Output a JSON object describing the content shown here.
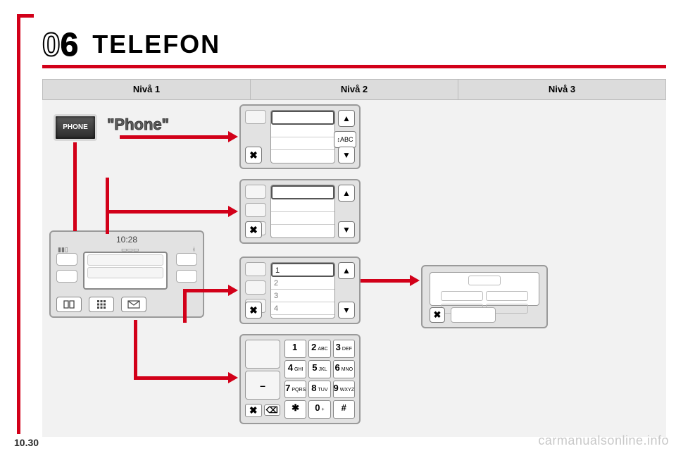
{
  "chapter": {
    "num_prefix": "0",
    "num": "6",
    "title": "TELEFON"
  },
  "columns": {
    "c1": "Nivå 1",
    "c2": "Nivå 2",
    "c3": "Nivå 3"
  },
  "phone_button": "PHONE",
  "phone_label": "\"Phone\"",
  "main_unit": {
    "time": "10:28"
  },
  "panel1": {
    "abc": "ABC"
  },
  "panel3": {
    "rows": [
      "1",
      "2",
      "3",
      "4"
    ]
  },
  "keypad": {
    "dash": "–",
    "keys": [
      {
        "d": "1",
        "s": ""
      },
      {
        "d": "2",
        "s": "ABC"
      },
      {
        "d": "3",
        "s": "DEF"
      },
      {
        "d": "4",
        "s": "GHI"
      },
      {
        "d": "5",
        "s": "JKL"
      },
      {
        "d": "6",
        "s": "MNO"
      },
      {
        "d": "7",
        "s": "PQRS"
      },
      {
        "d": "8",
        "s": "TUV"
      },
      {
        "d": "9",
        "s": "WXYZ"
      },
      {
        "d": "✱",
        "s": ""
      },
      {
        "d": "0",
        "s": "+"
      },
      {
        "d": "#",
        "s": ""
      }
    ],
    "x": "✖",
    "bksp": "⌫"
  },
  "close_x": "✖",
  "up": "▲",
  "down": "▼",
  "watermark": "carmanualsonline.info",
  "footer_page": "10.30"
}
